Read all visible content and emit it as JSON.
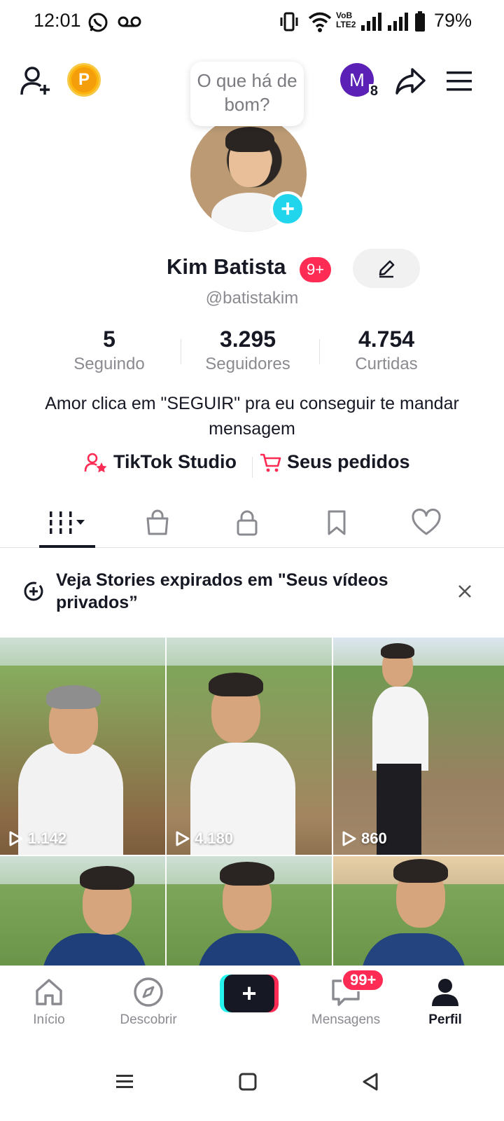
{
  "status_bar": {
    "time": "12:01",
    "battery": "79%",
    "icons": [
      "whatsapp-icon",
      "voicemail-icon",
      "vibrate-icon",
      "wifi-icon",
      "volte-icon",
      "signal-icon",
      "signal-icon",
      "battery-icon"
    ]
  },
  "header": {
    "coin_label": "P",
    "account_initial": "M",
    "account_badge": "8"
  },
  "bubble": {
    "text": "O que há de bom?"
  },
  "profile": {
    "name": "Kim Batista",
    "badge": "9+",
    "username": "@batistakim",
    "bio": "Amor clica em \"SEGUIR\" pra eu conseguir te mandar mensagem"
  },
  "stats": [
    {
      "value": "5",
      "label": "Seguindo"
    },
    {
      "value": "3.295",
      "label": "Seguidores"
    },
    {
      "value": "4.754",
      "label": "Curtidas"
    }
  ],
  "links": {
    "studio": "TikTok Studio",
    "orders": "Seus pedidos"
  },
  "tabs": [
    "videos-grid-icon",
    "shop-bag-icon",
    "lock-icon",
    "bookmark-icon",
    "heart-icon"
  ],
  "stories_banner": {
    "text": "Veja Stories expirados em \"Seus vídeos privados”"
  },
  "videos": [
    {
      "views": "1.142"
    },
    {
      "views": "4.180"
    },
    {
      "views": "860"
    },
    {
      "views": ""
    },
    {
      "views": ""
    },
    {
      "views": ""
    }
  ],
  "bottom_nav": {
    "items": [
      {
        "label": "Início"
      },
      {
        "label": "Descobrir"
      },
      {
        "label": ""
      },
      {
        "label": "Mensagens"
      },
      {
        "label": "Perfil"
      }
    ],
    "messages_badge": "99+"
  },
  "colors": {
    "accent_red": "#fe2c55",
    "accent_cyan": "#25f4ee",
    "text_primary": "#161823",
    "text_secondary": "#8a8b91"
  }
}
